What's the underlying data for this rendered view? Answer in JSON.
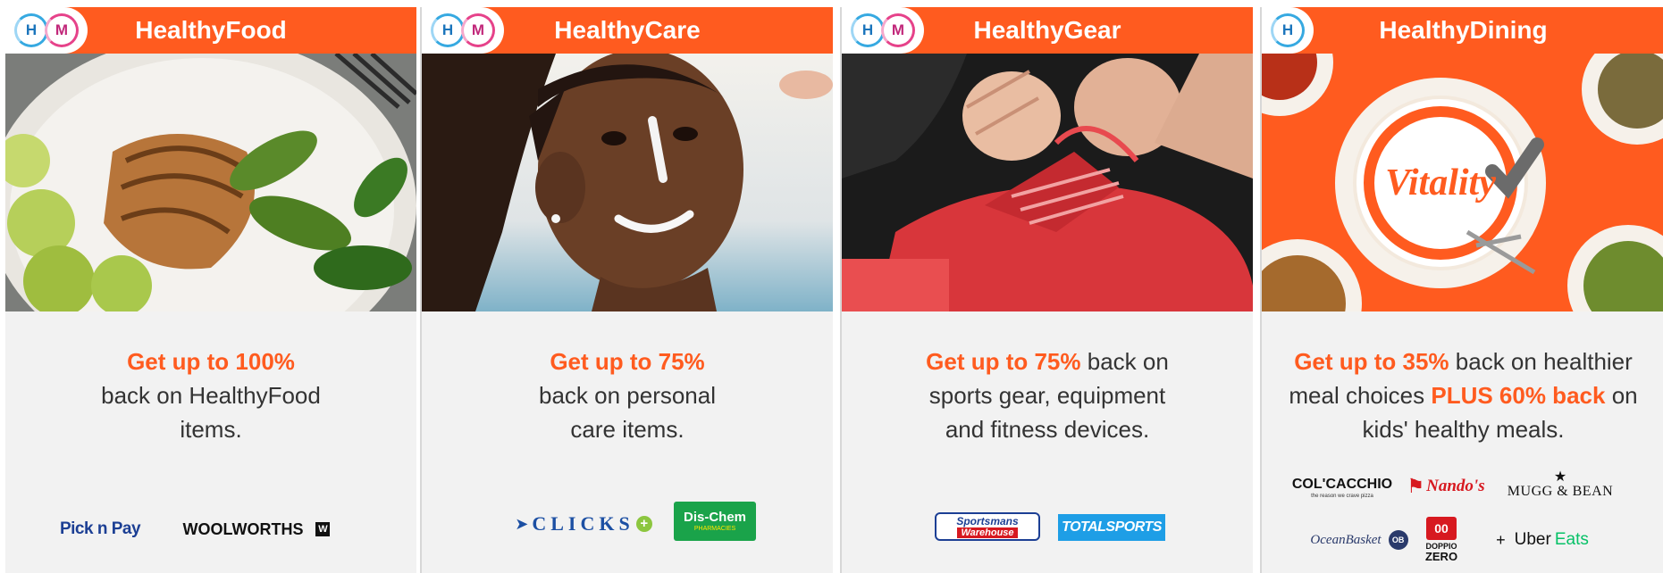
{
  "brand_colors": {
    "accent": "#ff5b1f",
    "h_ring": "#36a9e1",
    "m_ring": "#e6428a",
    "card_bg": "#f2f2f2"
  },
  "badges": {
    "h": "H",
    "m": "M"
  },
  "cards": [
    {
      "title": "HealthyFood",
      "image": "grilled-chicken-salad-plate",
      "highlight": "Get up to 100%",
      "body": "back on HealthyFood items.",
      "partners": [
        "Pick n Pay",
        "WOOLWORTHS"
      ]
    },
    {
      "title": "HealthyCare",
      "image": "girl-with-sunscreen",
      "highlight": "Get up to 75%",
      "body": "back on personal care items.",
      "partners": [
        "CLICKS",
        "Dis-Chem",
        "PHARMACIES"
      ]
    },
    {
      "title": "HealthyGear",
      "image": "tying-red-running-shoe",
      "highlight": "Get up to 75%",
      "body": "back on sports gear, equipment and fitness devices.",
      "partners": [
        "Sportsmans",
        "Warehouse",
        "TOTALSPORTS"
      ]
    },
    {
      "title": "HealthyDining",
      "image": "vitality-plate-with-meals",
      "image_text": "Vitality",
      "highlight": "Get up to 35%",
      "body_1": "back on healthier meal choices",
      "highlight_2": "PLUS 60% back",
      "body_2": "on kids' healthy meals.",
      "partners": [
        "COL'CACCHIO",
        "the reason we crave pizza",
        "Nando's",
        "MUGG & BEAN",
        "OceanBasket",
        "OB",
        "DOPPIO",
        "ZERO",
        "+",
        "Uber",
        "Eats"
      ]
    }
  ]
}
